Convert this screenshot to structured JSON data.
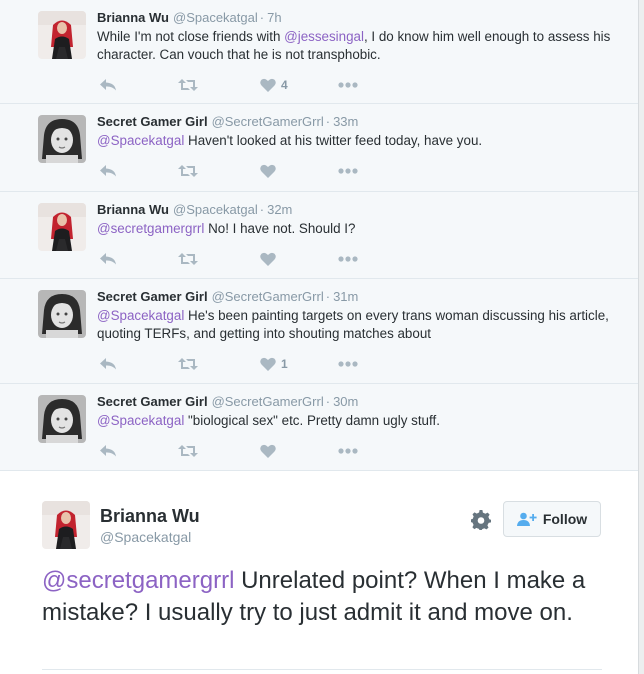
{
  "colors": {
    "mention": "#8c63c4",
    "muted": "#8899a6",
    "text": "#292f33",
    "background": "#f5f8fa"
  },
  "tweets": [
    {
      "name": "Brianna Wu",
      "handle": "@Spacekatgal",
      "time": "7h",
      "avatar": "brianna",
      "mention": "",
      "before": "While I'm not close friends with ",
      "inline_mention": "@jessesingal",
      "after": ", I do know him well enough to assess his character. Can vouch that he is not transphobic.",
      "likes": "4"
    },
    {
      "name": "Secret Gamer Girl",
      "handle": "@SecretGamerGrrl",
      "time": "33m",
      "avatar": "secret",
      "mention": "@Spacekatgal",
      "before": " Haven't looked at his twitter feed today, have you.",
      "inline_mention": "",
      "after": "",
      "likes": ""
    },
    {
      "name": "Brianna Wu",
      "handle": "@Spacekatgal",
      "time": "32m",
      "avatar": "brianna",
      "mention": "@secretgamergrrl",
      "before": " No! I have not. Should I?",
      "inline_mention": "",
      "after": "",
      "likes": ""
    },
    {
      "name": "Secret Gamer Girl",
      "handle": "@SecretGamerGrrl",
      "time": "31m",
      "avatar": "secret",
      "mention": "@Spacekatgal",
      "before": " He's been painting targets on every trans woman discussing his article, quoting TERFs, and getting into shouting matches about",
      "inline_mention": "",
      "after": "",
      "likes": "1"
    },
    {
      "name": "Secret Gamer Girl",
      "handle": "@SecretGamerGrrl",
      "time": "30m",
      "avatar": "secret",
      "mention": "@Spacekatgal",
      "before": " \"biological sex\" etc. Pretty damn ugly stuff.",
      "inline_mention": "",
      "after": "",
      "likes": ""
    }
  ],
  "main_tweet": {
    "name": "Brianna Wu",
    "handle": "@Spacekatgal",
    "follow_label": "Follow",
    "mention": "@secretgamergrrl",
    "text": " Unrelated point? When I make a mistake? I usually try to just admit it and move on."
  },
  "icons": {
    "reply": "reply-icon",
    "retweet": "retweet-icon",
    "like": "heart-icon",
    "more": "more-icon",
    "settings": "gear-icon",
    "follow": "add-user-icon"
  }
}
